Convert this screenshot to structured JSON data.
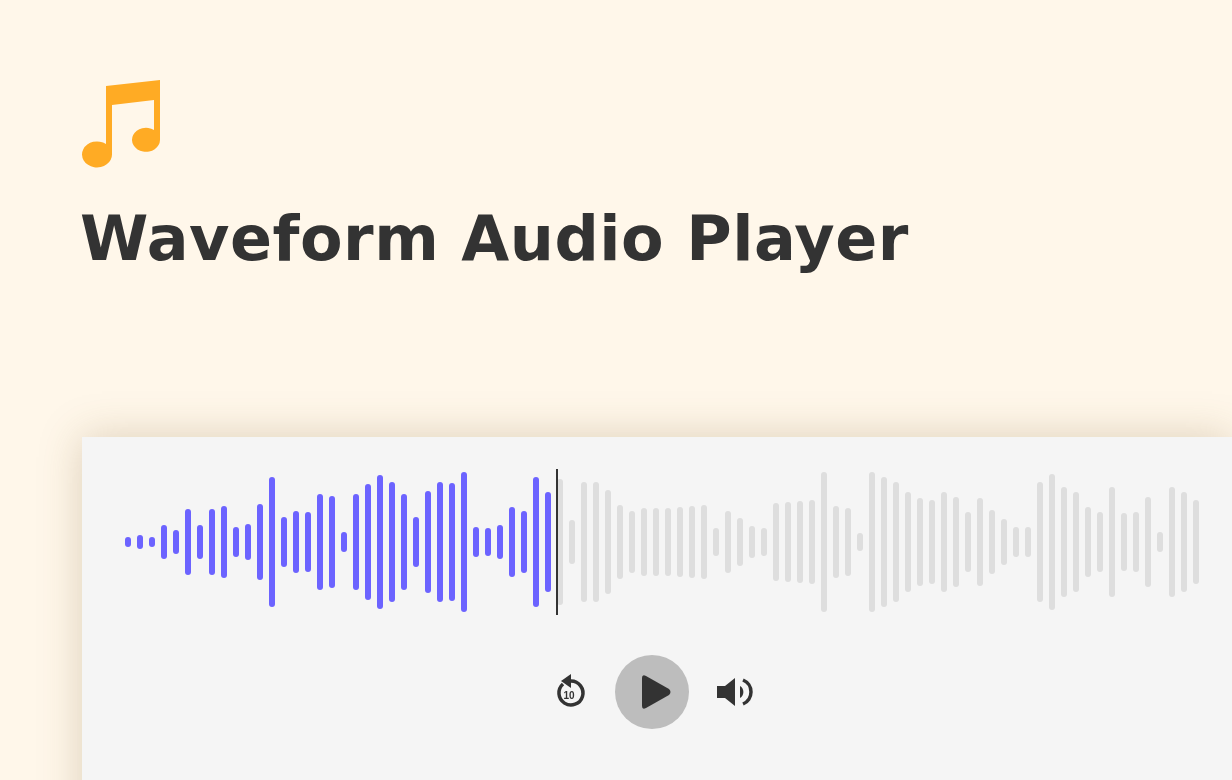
{
  "title": "Waveform Audio Player",
  "player": {
    "level": 0.4,
    "rewind_label": "10",
    "playing": false
  }
}
